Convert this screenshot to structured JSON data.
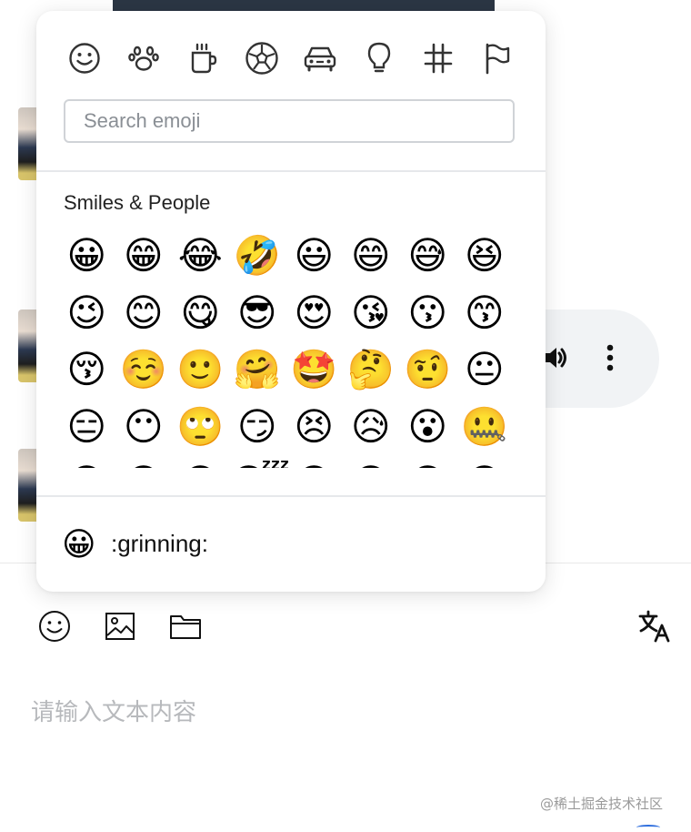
{
  "emoji_picker": {
    "categories": [
      {
        "name": "smiley-icon"
      },
      {
        "name": "paw-icon"
      },
      {
        "name": "cup-icon"
      },
      {
        "name": "ball-icon"
      },
      {
        "name": "car-icon"
      },
      {
        "name": "lightbulb-icon"
      },
      {
        "name": "hash-icon"
      },
      {
        "name": "flag-icon"
      }
    ],
    "search_placeholder": "Search emoji",
    "category_title": "Smiles & People",
    "emojis": [
      "😀",
      "😁",
      "😂",
      "🤣",
      "😃",
      "😄",
      "😅",
      "😆",
      "😉",
      "😊",
      "😋",
      "😎",
      "😍",
      "😘",
      "😗",
      "😙",
      "😚",
      "☺️",
      "🙂",
      "🤗",
      "🤩",
      "🤔",
      "🤨",
      "😐",
      "😑",
      "😶",
      "🙄",
      "😏",
      "😣",
      "😥",
      "😮",
      "🤐",
      "😯",
      "😪",
      "😫",
      "😴",
      "😌",
      "😛",
      "😜",
      "😝"
    ],
    "preview_emoji": "😀",
    "preview_code": ":grinning:"
  },
  "toolbar": {
    "icons": [
      "smiley-icon",
      "image-icon",
      "folder-icon",
      "translate-icon"
    ]
  },
  "composer": {
    "placeholder": "请输入文本内容"
  },
  "watermark": "@稀土掘金技术社区",
  "colors": {
    "accent": "#2f6fde",
    "panel_border": "#d0d3d7"
  }
}
